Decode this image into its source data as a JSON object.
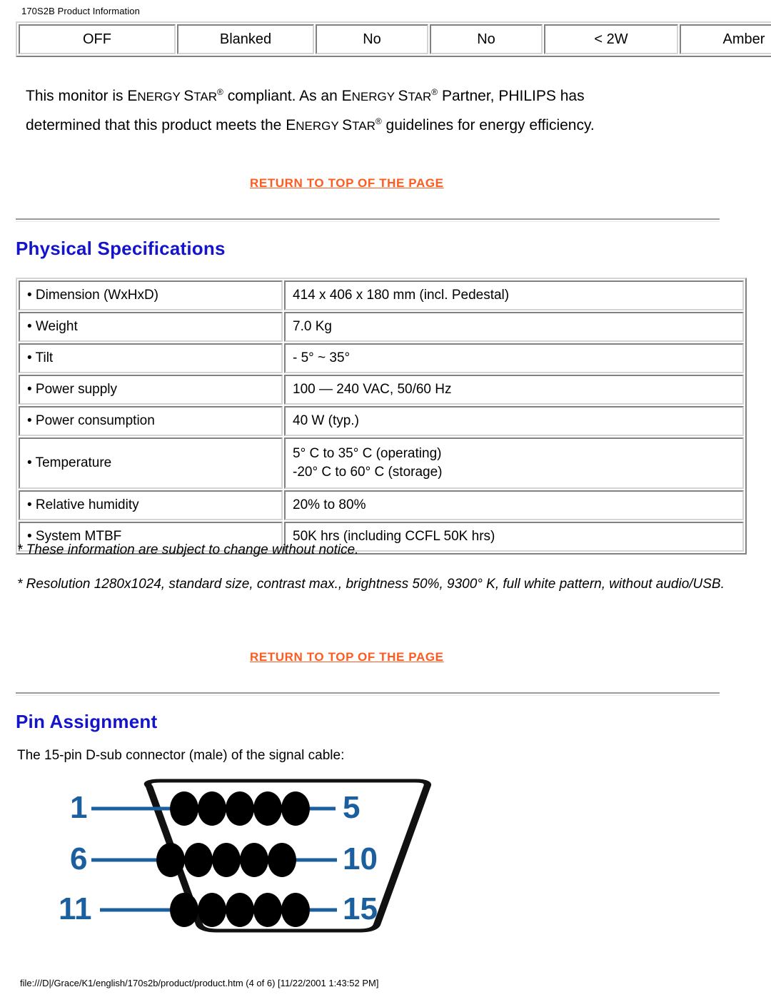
{
  "header": {
    "title": "170S2B Product Information"
  },
  "power_table": {
    "row": [
      "OFF",
      "Blanked",
      "No",
      "No",
      "< 2W",
      "Amber"
    ]
  },
  "energy_star": {
    "line1_a": "This monitor is ",
    "es1_big1": "E",
    "es1_sm1": "NERGY ",
    "es1_big2": "S",
    "es1_sm2": "TAR",
    "line1_b": " compliant. As an ",
    "es2_big1": "E",
    "es2_sm1": "NERGY ",
    "es2_big2": "S",
    "es2_sm2": "TAR",
    "line1_c": " Partner, PHILIPS has determined that this product meets the ",
    "es3_big1": "E",
    "es3_sm1": "NERGY ",
    "es3_big2": "S",
    "es3_sm2": "TAR",
    "line1_d": " guidelines for energy efficiency.",
    "registered": "®"
  },
  "links": {
    "return_to_top": "RETURN TO TOP OF THE PAGE"
  },
  "sections": {
    "physical_heading": "Physical Specifications",
    "pin_heading": "Pin Assignment",
    "pin_intro": "The 15-pin D-sub connector (male) of the signal cable:"
  },
  "spec_table": {
    "rows": [
      {
        "label": "• Dimension (WxHxD)",
        "value": "414 x 406 x 180 mm (incl. Pedestal)"
      },
      {
        "label": "• Weight",
        "value": "7.0 Kg"
      },
      {
        "label": "• Tilt",
        "value": "- 5° ~ 35°"
      },
      {
        "label": "• Power supply",
        "value": "100 — 240 VAC, 50/60 Hz"
      },
      {
        "label": "• Power consumption",
        "value": "40 W (typ.)"
      },
      {
        "label": "• Temperature",
        "value_line1": "5° C to 35° C (operating)",
        "value_line2": "-20° C to 60° C (storage)"
      },
      {
        "label": "• Relative humidity",
        "value": "20% to 80%"
      },
      {
        "label": "• System MTBF",
        "value": "50K hrs (including CCFL 50K hrs)"
      }
    ]
  },
  "notes": {
    "note1": "* These information are subject to change without notice.",
    "note2": "* Resolution 1280x1024, standard size, contrast max., brightness 50%, 9300° K, full white pattern, without audio/USB."
  },
  "dsub": {
    "labels": {
      "pin_1": "1",
      "pin_5": "5",
      "pin_6": "6",
      "pin_10": "10",
      "pin_11": "11",
      "pin_15": "15"
    },
    "label_color": "#1c5f9e",
    "pin_color": "#000000",
    "rows": 3,
    "pins_per_row": 5,
    "total_pins": 15
  },
  "footer": {
    "path": "file:///D|/Grace/K1/english/170s2b/product/product.htm (4 of 6) [11/22/2001 1:43:52 PM]"
  },
  "colors": {
    "heading_blue": "#1414cc",
    "link_orange": "#ff5a1f",
    "dsub_blue": "#1c5f9e"
  }
}
